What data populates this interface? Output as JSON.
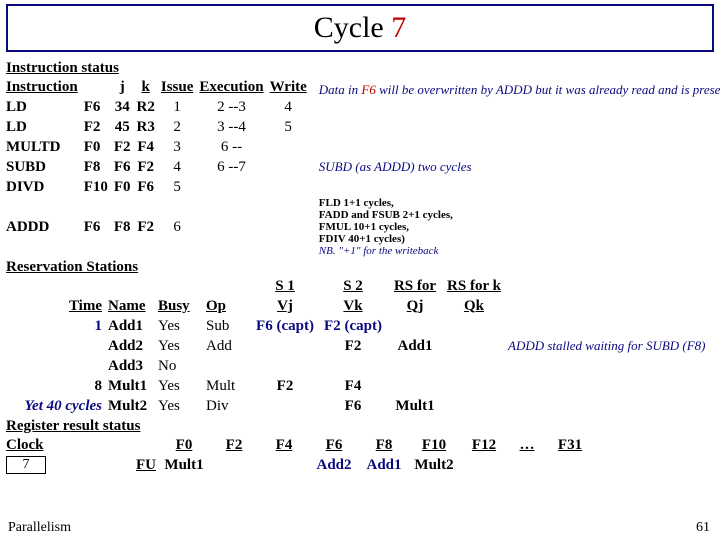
{
  "title": {
    "prefix": "Cycle ",
    "num": "7"
  },
  "sections": {
    "instr_status": "Instruction status",
    "res_stations": "Reservation Stations",
    "reg_status": "Register result status"
  },
  "ih": {
    "instr": "Instruction",
    "j": "j",
    "k": "k",
    "issue": "Issue",
    "exec": "Execution",
    "write": "Write"
  },
  "instr": [
    {
      "op": "LD",
      "d": "F6",
      "j": "34",
      "k": "R2",
      "is": "1",
      "ex": "2 --3",
      "wr": "4"
    },
    {
      "op": "LD",
      "d": "F2",
      "j": "45",
      "k": "R3",
      "is": "2",
      "ex": "3 --4",
      "wr": "5"
    },
    {
      "op": "MULTD",
      "d": "F0",
      "j": "F2",
      "k": "F4",
      "is": "3",
      "ex": "6 --",
      "wr": ""
    },
    {
      "op": "SUBD",
      "d": "F8",
      "j": "F6",
      "k": "F2",
      "is": "4",
      "ex": "6 --7",
      "wr": ""
    },
    {
      "op": "DIVD",
      "d": "F10",
      "j": "F0",
      "k": "F6",
      "is": "5",
      "ex": "",
      "wr": ""
    },
    {
      "op": "ADDD",
      "d": "F6",
      "j": "F8",
      "k": "F2",
      "is": "6",
      "ex": "",
      "wr": ""
    }
  ],
  "rh": {
    "time": "Time",
    "name": "Name",
    "busy": "Busy",
    "op": "Op",
    "s1": "S 1",
    "s2": "S 2",
    "rsj": "RS for",
    "rsk": "RS for k",
    "vj": "Vj",
    "vk": "Vk",
    "qj": "Qj",
    "qk": "Qk"
  },
  "rs": [
    {
      "time": "1",
      "name": "Add1",
      "busy": "Yes",
      "op": "Sub",
      "vj": "F6 (capt)",
      "vk": "F2 (capt)",
      "qj": "",
      "qk": ""
    },
    {
      "time": "",
      "name": "Add2",
      "busy": "Yes",
      "op": "Add",
      "vj": "",
      "vk": "F2",
      "qj": "Add1",
      "qk": ""
    },
    {
      "time": "",
      "name": "Add3",
      "busy": "No",
      "op": "",
      "vj": "",
      "vk": "",
      "qj": "",
      "qk": ""
    },
    {
      "time": "8",
      "name": "Mult1",
      "busy": "Yes",
      "op": "Mult",
      "vj": "F2",
      "vk": "F4",
      "qj": "",
      "qk": ""
    },
    {
      "time": "Yet 40 cycles",
      "name": "Mult2",
      "busy": "Yes",
      "op": "Div",
      "vj": "",
      "vk": "F6",
      "qj": "Mult1",
      "qk": ""
    }
  ],
  "reg": {
    "clock_label": "Clock",
    "clock": "7",
    "fu": "FU",
    "cols": [
      "F0",
      "F2",
      "F4",
      "F6",
      "F8",
      "F10",
      "F12",
      "…",
      "F31"
    ],
    "vals": [
      "Mult1",
      "",
      "",
      "Add2",
      "Add1",
      "Mult2",
      "",
      "",
      ""
    ]
  },
  "notes": {
    "n1a": "Data in ",
    "n1b": "F6",
    "n1c": " will be overwritten by ADDD but it was already read and is present in the RS of DIVD",
    "n2": "SUBD (as ADDD) two cycles",
    "n3": "ADDD stalled waiting for SUBD (F8)",
    "lat": {
      "l1": "FLD 1+1 cycles,",
      "l2": "FADD and FSUB 2+1 cycles,",
      "l3": "FMUL 10+1 cycles,",
      "l4": "FDIV 40+1 cycles)",
      "l5": "NB. \"+1\" for the writeback"
    }
  },
  "footer": {
    "left": "Parallelism",
    "right": "61"
  }
}
